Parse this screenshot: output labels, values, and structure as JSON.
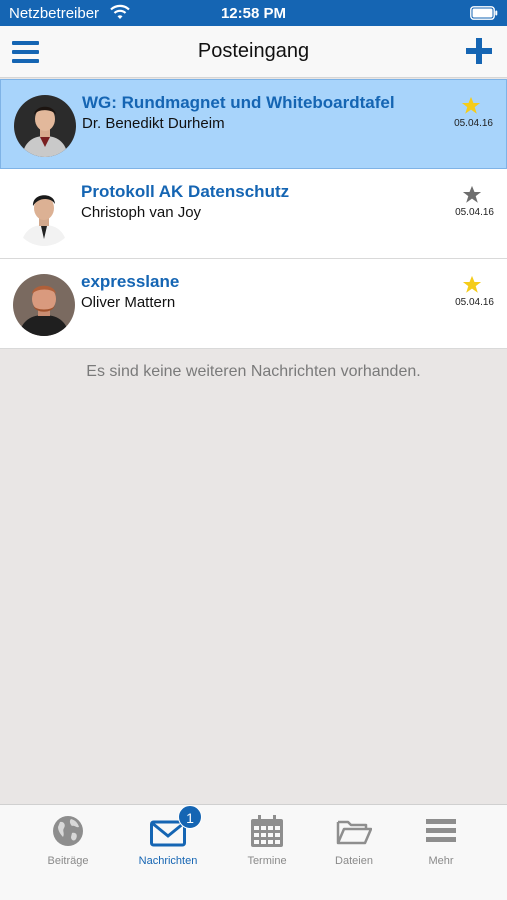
{
  "status_bar": {
    "carrier": "Netzbetreiber",
    "time": "12:58 PM"
  },
  "nav": {
    "title": "Posteingang"
  },
  "messages": [
    {
      "subject": "WG: Rundmagnet und Whiteboardtafel",
      "sender": "Dr. Benedikt Durheim",
      "date": "05.04.16",
      "starred": true,
      "selected": true
    },
    {
      "subject": "Protokoll AK Datenschutz",
      "sender": "Christoph van Joy",
      "date": "05.04.16",
      "starred": false,
      "selected": false
    },
    {
      "subject": "expresslane",
      "sender": "Oliver Mattern",
      "date": "05.04.16",
      "starred": true,
      "selected": false
    }
  ],
  "empty_note": "Es sind keine weiteren Nachrichten vorhanden.",
  "tabs": [
    {
      "label": "Beiträge",
      "icon": "globe-icon"
    },
    {
      "label": "Nachrichten",
      "icon": "envelope-icon",
      "badge": "1",
      "active": true
    },
    {
      "label": "Termine",
      "icon": "calendar-icon"
    },
    {
      "label": "Dateien",
      "icon": "folder-icon"
    },
    {
      "label": "Mehr",
      "icon": "menu-icon"
    }
  ],
  "colors": {
    "accent": "#1565b3",
    "selected_row": "#a8d4fb",
    "star_active": "#f5cc1a",
    "star_inactive": "#6e6e6e",
    "background": "#e9e6e5"
  }
}
